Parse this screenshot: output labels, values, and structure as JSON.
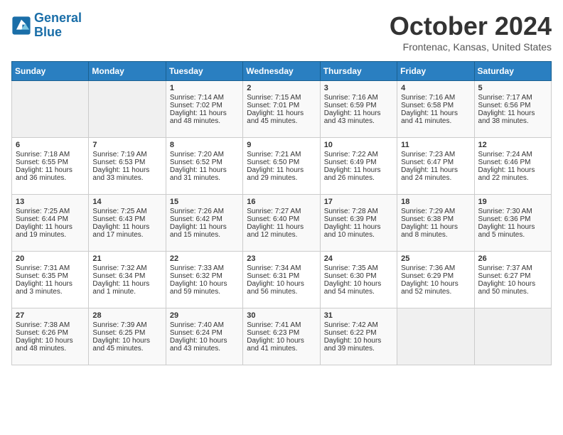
{
  "header": {
    "logo_line1": "General",
    "logo_line2": "Blue",
    "month": "October 2024",
    "location": "Frontenac, Kansas, United States"
  },
  "weekdays": [
    "Sunday",
    "Monday",
    "Tuesday",
    "Wednesday",
    "Thursday",
    "Friday",
    "Saturday"
  ],
  "weeks": [
    [
      {
        "day": "",
        "content": ""
      },
      {
        "day": "",
        "content": ""
      },
      {
        "day": "1",
        "content": "Sunrise: 7:14 AM\nSunset: 7:02 PM\nDaylight: 11 hours and 48 minutes."
      },
      {
        "day": "2",
        "content": "Sunrise: 7:15 AM\nSunset: 7:01 PM\nDaylight: 11 hours and 45 minutes."
      },
      {
        "day": "3",
        "content": "Sunrise: 7:16 AM\nSunset: 6:59 PM\nDaylight: 11 hours and 43 minutes."
      },
      {
        "day": "4",
        "content": "Sunrise: 7:16 AM\nSunset: 6:58 PM\nDaylight: 11 hours and 41 minutes."
      },
      {
        "day": "5",
        "content": "Sunrise: 7:17 AM\nSunset: 6:56 PM\nDaylight: 11 hours and 38 minutes."
      }
    ],
    [
      {
        "day": "6",
        "content": "Sunrise: 7:18 AM\nSunset: 6:55 PM\nDaylight: 11 hours and 36 minutes."
      },
      {
        "day": "7",
        "content": "Sunrise: 7:19 AM\nSunset: 6:53 PM\nDaylight: 11 hours and 33 minutes."
      },
      {
        "day": "8",
        "content": "Sunrise: 7:20 AM\nSunset: 6:52 PM\nDaylight: 11 hours and 31 minutes."
      },
      {
        "day": "9",
        "content": "Sunrise: 7:21 AM\nSunset: 6:50 PM\nDaylight: 11 hours and 29 minutes."
      },
      {
        "day": "10",
        "content": "Sunrise: 7:22 AM\nSunset: 6:49 PM\nDaylight: 11 hours and 26 minutes."
      },
      {
        "day": "11",
        "content": "Sunrise: 7:23 AM\nSunset: 6:47 PM\nDaylight: 11 hours and 24 minutes."
      },
      {
        "day": "12",
        "content": "Sunrise: 7:24 AM\nSunset: 6:46 PM\nDaylight: 11 hours and 22 minutes."
      }
    ],
    [
      {
        "day": "13",
        "content": "Sunrise: 7:25 AM\nSunset: 6:44 PM\nDaylight: 11 hours and 19 minutes."
      },
      {
        "day": "14",
        "content": "Sunrise: 7:25 AM\nSunset: 6:43 PM\nDaylight: 11 hours and 17 minutes."
      },
      {
        "day": "15",
        "content": "Sunrise: 7:26 AM\nSunset: 6:42 PM\nDaylight: 11 hours and 15 minutes."
      },
      {
        "day": "16",
        "content": "Sunrise: 7:27 AM\nSunset: 6:40 PM\nDaylight: 11 hours and 12 minutes."
      },
      {
        "day": "17",
        "content": "Sunrise: 7:28 AM\nSunset: 6:39 PM\nDaylight: 11 hours and 10 minutes."
      },
      {
        "day": "18",
        "content": "Sunrise: 7:29 AM\nSunset: 6:38 PM\nDaylight: 11 hours and 8 minutes."
      },
      {
        "day": "19",
        "content": "Sunrise: 7:30 AM\nSunset: 6:36 PM\nDaylight: 11 hours and 5 minutes."
      }
    ],
    [
      {
        "day": "20",
        "content": "Sunrise: 7:31 AM\nSunset: 6:35 PM\nDaylight: 11 hours and 3 minutes."
      },
      {
        "day": "21",
        "content": "Sunrise: 7:32 AM\nSunset: 6:34 PM\nDaylight: 11 hours and 1 minute."
      },
      {
        "day": "22",
        "content": "Sunrise: 7:33 AM\nSunset: 6:32 PM\nDaylight: 10 hours and 59 minutes."
      },
      {
        "day": "23",
        "content": "Sunrise: 7:34 AM\nSunset: 6:31 PM\nDaylight: 10 hours and 56 minutes."
      },
      {
        "day": "24",
        "content": "Sunrise: 7:35 AM\nSunset: 6:30 PM\nDaylight: 10 hours and 54 minutes."
      },
      {
        "day": "25",
        "content": "Sunrise: 7:36 AM\nSunset: 6:29 PM\nDaylight: 10 hours and 52 minutes."
      },
      {
        "day": "26",
        "content": "Sunrise: 7:37 AM\nSunset: 6:27 PM\nDaylight: 10 hours and 50 minutes."
      }
    ],
    [
      {
        "day": "27",
        "content": "Sunrise: 7:38 AM\nSunset: 6:26 PM\nDaylight: 10 hours and 48 minutes."
      },
      {
        "day": "28",
        "content": "Sunrise: 7:39 AM\nSunset: 6:25 PM\nDaylight: 10 hours and 45 minutes."
      },
      {
        "day": "29",
        "content": "Sunrise: 7:40 AM\nSunset: 6:24 PM\nDaylight: 10 hours and 43 minutes."
      },
      {
        "day": "30",
        "content": "Sunrise: 7:41 AM\nSunset: 6:23 PM\nDaylight: 10 hours and 41 minutes."
      },
      {
        "day": "31",
        "content": "Sunrise: 7:42 AM\nSunset: 6:22 PM\nDaylight: 10 hours and 39 minutes."
      },
      {
        "day": "",
        "content": ""
      },
      {
        "day": "",
        "content": ""
      }
    ]
  ]
}
